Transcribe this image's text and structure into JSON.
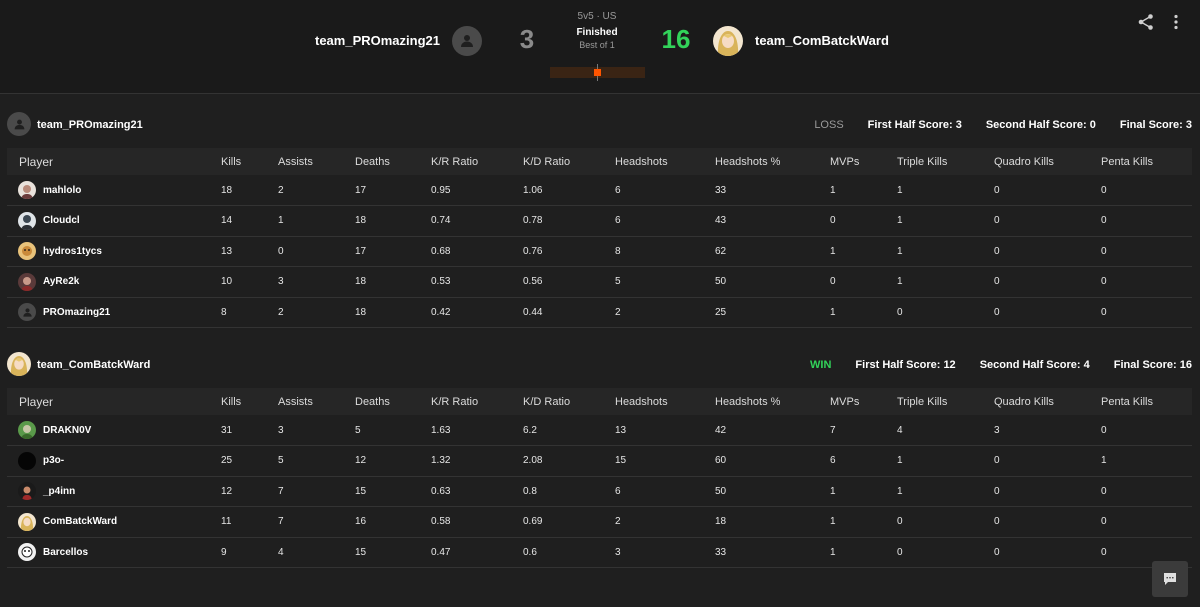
{
  "match": {
    "mode": "5v5 · US",
    "status": "Finished",
    "best_of": "Best of 1",
    "progress_fraction": 0.5
  },
  "team_left": {
    "name": "team_PROmazing21",
    "score": "3"
  },
  "team_right": {
    "name": "team_ComBatckWard",
    "score": "16"
  },
  "columns": [
    "Player",
    "Kills",
    "Assists",
    "Deaths",
    "K/R Ratio",
    "K/D Ratio",
    "Headshots",
    "Headshots %",
    "MVPs",
    "Triple Kills",
    "Quadro Kills",
    "Penta Kills"
  ],
  "teams": [
    {
      "name": "team_PROmazing21",
      "result": "LOSS",
      "first_half": "First Half Score: 3",
      "second_half": "Second Half Score: 0",
      "final": "Final Score: 3",
      "rows": [
        [
          "mahlolo",
          "18",
          "2",
          "17",
          "0.95",
          "1.06",
          "6",
          "33",
          "1",
          "1",
          "0",
          "0"
        ],
        [
          "Cloudcl",
          "14",
          "1",
          "18",
          "0.74",
          "0.78",
          "6",
          "43",
          "0",
          "1",
          "0",
          "0"
        ],
        [
          "hydros1tycs",
          "13",
          "0",
          "17",
          "0.68",
          "0.76",
          "8",
          "62",
          "1",
          "1",
          "0",
          "0"
        ],
        [
          "AyRe2k",
          "10",
          "3",
          "18",
          "0.53",
          "0.56",
          "5",
          "50",
          "0",
          "1",
          "0",
          "0"
        ],
        [
          "PROmazing21",
          "8",
          "2",
          "18",
          "0.42",
          "0.44",
          "2",
          "25",
          "1",
          "0",
          "0",
          "0"
        ]
      ]
    },
    {
      "name": "team_ComBatckWard",
      "result": "WIN",
      "first_half": "First Half Score: 12",
      "second_half": "Second Half Score: 4",
      "final": "Final Score: 16",
      "rows": [
        [
          "DRAKN0V",
          "31",
          "3",
          "5",
          "1.63",
          "6.2",
          "13",
          "42",
          "7",
          "4",
          "3",
          "0"
        ],
        [
          "p3o-",
          "25",
          "5",
          "12",
          "1.32",
          "2.08",
          "15",
          "60",
          "6",
          "1",
          "0",
          "1"
        ],
        [
          "_p4inn",
          "12",
          "7",
          "15",
          "0.63",
          "0.8",
          "6",
          "50",
          "1",
          "1",
          "0",
          "0"
        ],
        [
          "ComBatckWard",
          "11",
          "7",
          "16",
          "0.58",
          "0.69",
          "2",
          "18",
          "1",
          "0",
          "0",
          "0"
        ],
        [
          "Barcellos",
          "9",
          "4",
          "15",
          "0.47",
          "0.6",
          "3",
          "33",
          "1",
          "0",
          "0",
          "0"
        ]
      ]
    }
  ],
  "colors": {
    "win": "#32d35a",
    "loss": "#9a9a9a",
    "accent": "#ff5500",
    "bg": "#1f1f1f"
  },
  "icons": {
    "share": "share-icon",
    "more": "more-vertical-icon",
    "chat": "chat-icon"
  }
}
